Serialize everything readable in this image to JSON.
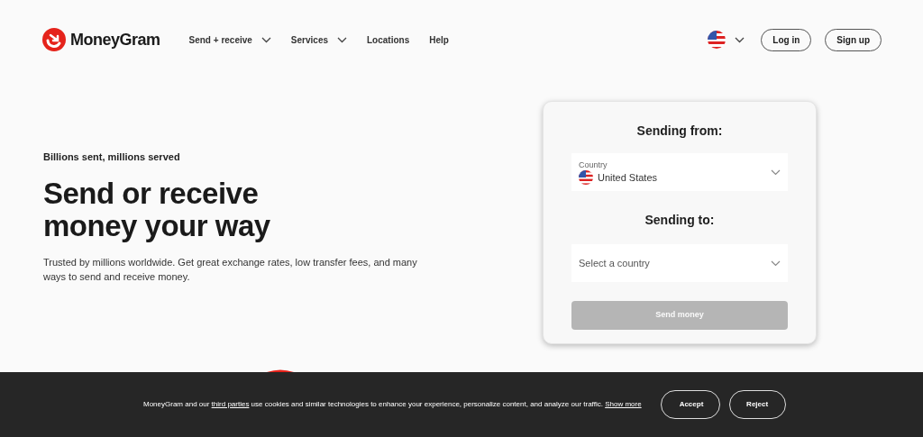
{
  "header": {
    "logo": "MoneyGram",
    "nav": [
      {
        "label": "Send + receive",
        "kind": "dropdown"
      },
      {
        "label": "Services",
        "kind": "dropdown"
      },
      {
        "label": "Locations",
        "kind": "link"
      },
      {
        "label": "Help",
        "kind": "link"
      }
    ],
    "buttons": [
      "Log in",
      "Sign up"
    ]
  },
  "hero": {
    "eyebrow": "Billions sent, millions served",
    "title_lines": [
      "Send or receive",
      "money your way"
    ],
    "description": "Trusted by millions worldwide. Get great exchange rates, low transfer fees, and many ways to send and receive money."
  },
  "transfer_card": {
    "from_heading": "Sending from:",
    "from_field": {
      "label": "Country",
      "value": "United States"
    },
    "to_heading": "Sending to:",
    "to_field": {
      "placeholder": "Select a country"
    },
    "button": {
      "label": "Send money",
      "disabled": true
    }
  },
  "cookie_banner": {
    "parts": [
      {
        "kind": "text",
        "text": "MoneyGram and our "
      },
      {
        "kind": "link",
        "text": "third parties"
      },
      {
        "kind": "text",
        "text": " use cookies and similar technologies to enhance your experience, personalize content, and analyze our traffic. "
      },
      {
        "kind": "link",
        "text": "Show more"
      }
    ],
    "buttons": [
      "Accept",
      "Reject"
    ]
  }
}
